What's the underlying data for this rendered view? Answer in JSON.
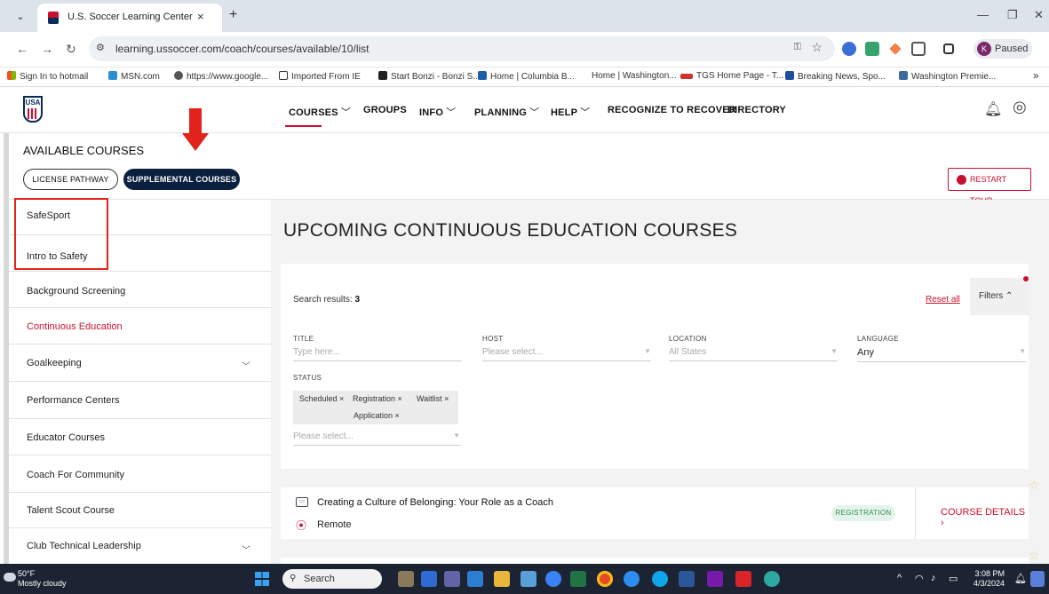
{
  "browser": {
    "tab_title": "U.S. Soccer Learning Center",
    "tab_close": "×",
    "new_tab": "+",
    "tab_menu": "⌄",
    "url": "learning.ussoccer.com/coach/courses/available/10/list",
    "profile_letter": "K",
    "profile_status": "Paused",
    "minimize": "—",
    "restore": "❐",
    "close": "✕"
  },
  "bookmarks": [
    "Sign In to hotmail",
    "MSN.com",
    "https://www.google...",
    "Imported From IE",
    "Start Bonzi - Bonzi S...",
    "Home | Columbia B...",
    "Home | Washington...",
    "TGS Home Page - T...",
    "Breaking News, Spo...",
    "Washington Premie..."
  ],
  "bookmarks_more": "»",
  "header": {
    "logo_text": "USA",
    "nav": [
      {
        "label": "COURSES",
        "chevron": true
      },
      {
        "label": "GROUPS",
        "chevron": false
      },
      {
        "label": "INFO",
        "chevron": true
      },
      {
        "label": "PLANNING",
        "chevron": true
      },
      {
        "label": "HELP",
        "chevron": true
      },
      {
        "label": "RECOGNIZE TO RECOVER",
        "chevron": false
      },
      {
        "label": "DIRECTORY",
        "chevron": false
      }
    ]
  },
  "available": {
    "heading": "AVAILABLE COURSES",
    "license_pathway": "LICENSE PATHWAY",
    "supplemental_courses": "SUPPLEMENTAL COURSES",
    "restart_tour": "RESTART TOUR"
  },
  "sidebar": {
    "items": [
      {
        "label": "SafeSport",
        "chevron": false,
        "active": false
      },
      {
        "label": "Intro to Safety",
        "chevron": false,
        "active": false
      },
      {
        "label": "Background Screening",
        "chevron": false,
        "active": false
      },
      {
        "label": "Continuous Education",
        "chevron": false,
        "active": true
      },
      {
        "label": "Goalkeeping",
        "chevron": true,
        "active": false
      },
      {
        "label": "Performance Centers",
        "chevron": false,
        "active": false
      },
      {
        "label": "Educator Courses",
        "chevron": false,
        "active": false
      },
      {
        "label": "Coach For Community",
        "chevron": false,
        "active": false
      },
      {
        "label": "Talent Scout Course",
        "chevron": false,
        "active": false
      },
      {
        "label": "Club Technical Leadership",
        "chevron": true,
        "active": false
      }
    ]
  },
  "main": {
    "title": "UPCOMING CONTINUOUS EDUCATION COURSES",
    "results_label": "Search results:",
    "results_count": "3",
    "reset_all": "Reset all",
    "filters": "Filters",
    "filters_chevron": "^",
    "filter_fields": {
      "title_label": "TITLE",
      "title_placeholder": "Type here...",
      "host_label": "HOST",
      "host_placeholder": "Please select...",
      "location_label": "LOCATION",
      "location_value": "All States",
      "language_label": "LANGUAGE",
      "language_value": "Any",
      "status_label": "STATUS",
      "status_chips": [
        "Scheduled ×",
        "Registration ×",
        "Waitlist ×",
        "Application ×"
      ],
      "status_placeholder": "Please select..."
    },
    "course": {
      "title": "Creating a Culture of Belonging: Your Role as a Coach",
      "location": "Remote",
      "status": "REGISTRATION",
      "details": "COURSE DETAILS"
    }
  },
  "taskbar": {
    "temp": "50°F",
    "weather": "Mostly cloudy",
    "search": "Search",
    "time": "3:08 PM",
    "date": "4/3/2024"
  },
  "colors": {
    "brand_red": "#c8102e",
    "navy": "#0b1f3f",
    "annotation_red": "#e1231b"
  }
}
